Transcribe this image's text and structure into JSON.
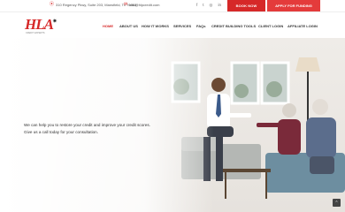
{
  "topbar": {
    "address": "310 Regency Pkwy, Suite 203, Mansfield, Tx 76063",
    "phone": "info@hlpcredit.com",
    "social_icons": [
      "facebook-icon",
      "twitter-icon",
      "instagram-icon",
      "linkedin-icon"
    ],
    "social_glyphs": [
      "f",
      "t",
      "◎",
      "in"
    ],
    "book_label": "BOOK NOW",
    "apply_label": "APPLY FOR FUNDING"
  },
  "logo": {
    "text": "HLA",
    "subtext": "CREDIT EXPERTS"
  },
  "nav": {
    "items": [
      "HOME",
      "ABOUT US",
      "HOW IT WORKS",
      "SERVICES",
      "FAQs",
      "CREDIT BUILDING TOOLS",
      "CLIENT LOGIN",
      "AFFILIATE LOGIN"
    ],
    "active": "HOME"
  },
  "hero": {
    "line1": "We can help you to restore your credit and improve your credit scores.",
    "line2": "Give us a call today for your consultation."
  },
  "colors": {
    "accent": "#d62828",
    "apply": "#e43b3b"
  }
}
